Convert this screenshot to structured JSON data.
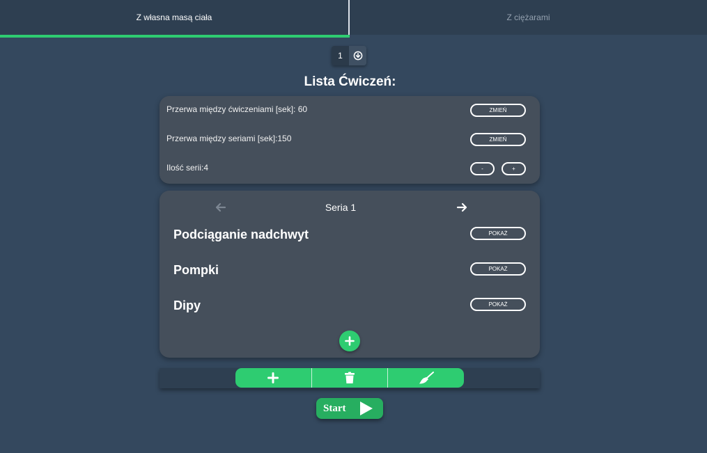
{
  "tabs": {
    "bodyweight": "Z własna masą ciała",
    "weights": "Z ciężarami"
  },
  "series_select": {
    "value": "1",
    "icon": "download-circle-icon"
  },
  "title": "Lista Ćwiczeń:",
  "settings": {
    "rest_exercises": {
      "label": "Przerwa między ćwiczeniami [sek]: 60",
      "button": "ZMIEŃ"
    },
    "rest_series": {
      "label": "Przerwa między seriami [sek]:150",
      "button": "ZMIEŃ"
    },
    "series_count": {
      "label": "Ilość serii:4",
      "minus": "-",
      "plus": "+"
    }
  },
  "seria": {
    "label": "Seria 1",
    "exercises": [
      {
        "name": "Podciąganie nadchwyt",
        "button": "POKAŻ"
      },
      {
        "name": "Pompki",
        "button": "POKAŻ"
      },
      {
        "name": "Dipy",
        "button": "POKAŻ"
      }
    ]
  },
  "toolbar": {
    "icons": [
      "plus-icon",
      "trash-icon",
      "broom-icon"
    ]
  },
  "start": {
    "label": "Start"
  },
  "colors": {
    "accent": "#2ecc71",
    "background": "#34485e",
    "card": "#454f5b"
  }
}
